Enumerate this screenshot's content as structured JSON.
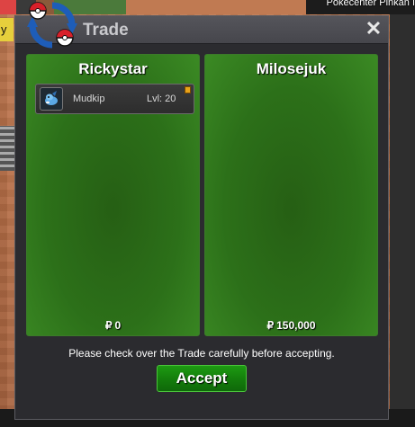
{
  "background": {
    "location_label": "Pokecenter Pinkan I",
    "side_chip_text": "y"
  },
  "window": {
    "title": "Trade",
    "close_glyph": "✕"
  },
  "left_panel": {
    "player_name": "Rickystar",
    "items": [
      {
        "name": "Mudkip",
        "level": "Lvl: 20",
        "icon": "mudkip-icon"
      }
    ],
    "money_symbol": "₽",
    "money": "0"
  },
  "right_panel": {
    "player_name": "Milosejuk",
    "money_symbol": "₽",
    "money": "150,000"
  },
  "notice": "Please check over the Trade carefully before accepting.",
  "accept_label": "Accept",
  "colors": {
    "panel_green": "#2c7019",
    "accept_green": "#137a0b",
    "window_bg": "#2b2b2f"
  }
}
